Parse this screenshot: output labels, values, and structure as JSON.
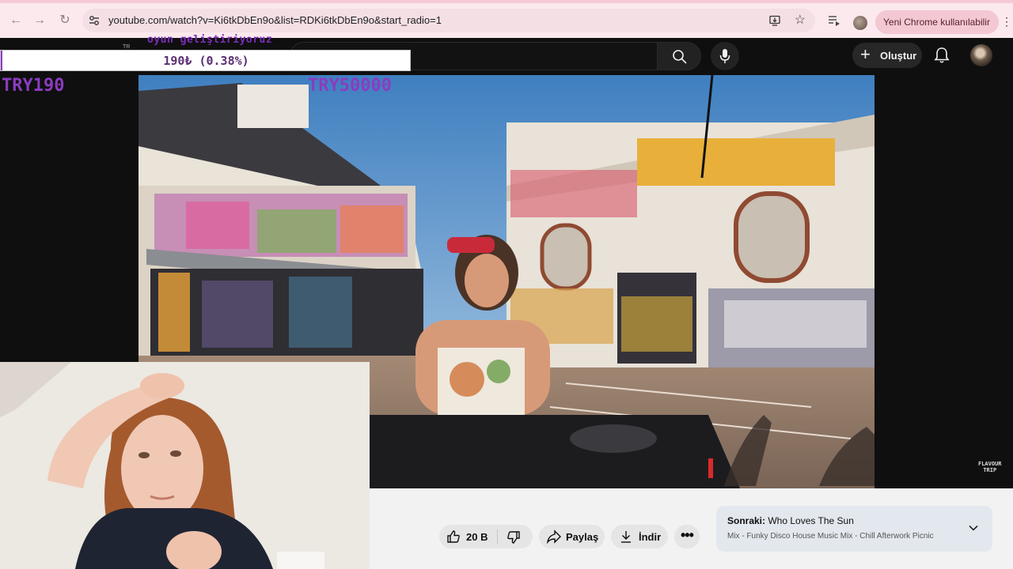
{
  "browser": {
    "url": "youtube.com/watch?v=Ki6tkDbEn9o&list=RDKi6tkDbEn9o&start_radio=1",
    "update_label": "Yeni Chrome kullanılabilir"
  },
  "youtube": {
    "create_label": "Oluştur"
  },
  "stream_overlay": {
    "label": "oyun geliştiriyoruz",
    "tag": "TR",
    "donation_text": "190₺ (0.38%)",
    "donation_progress": 0.0038,
    "goal_current": "TRY190",
    "goal_target": "TRY50000",
    "accent_color": "#8b3cc0"
  },
  "video": {
    "watermark_line1": "FLAVOUR",
    "watermark_line2": "TRIP"
  },
  "actions": {
    "like_count": "20 B",
    "share_label": "Paylaş",
    "download_label": "İndir"
  },
  "up_next": {
    "prefix": "Sonraki:",
    "title": "Who Loves The Sun",
    "subtitle": "Mix - Funky Disco House Music Mix - Chill Afterwork Picnic"
  }
}
